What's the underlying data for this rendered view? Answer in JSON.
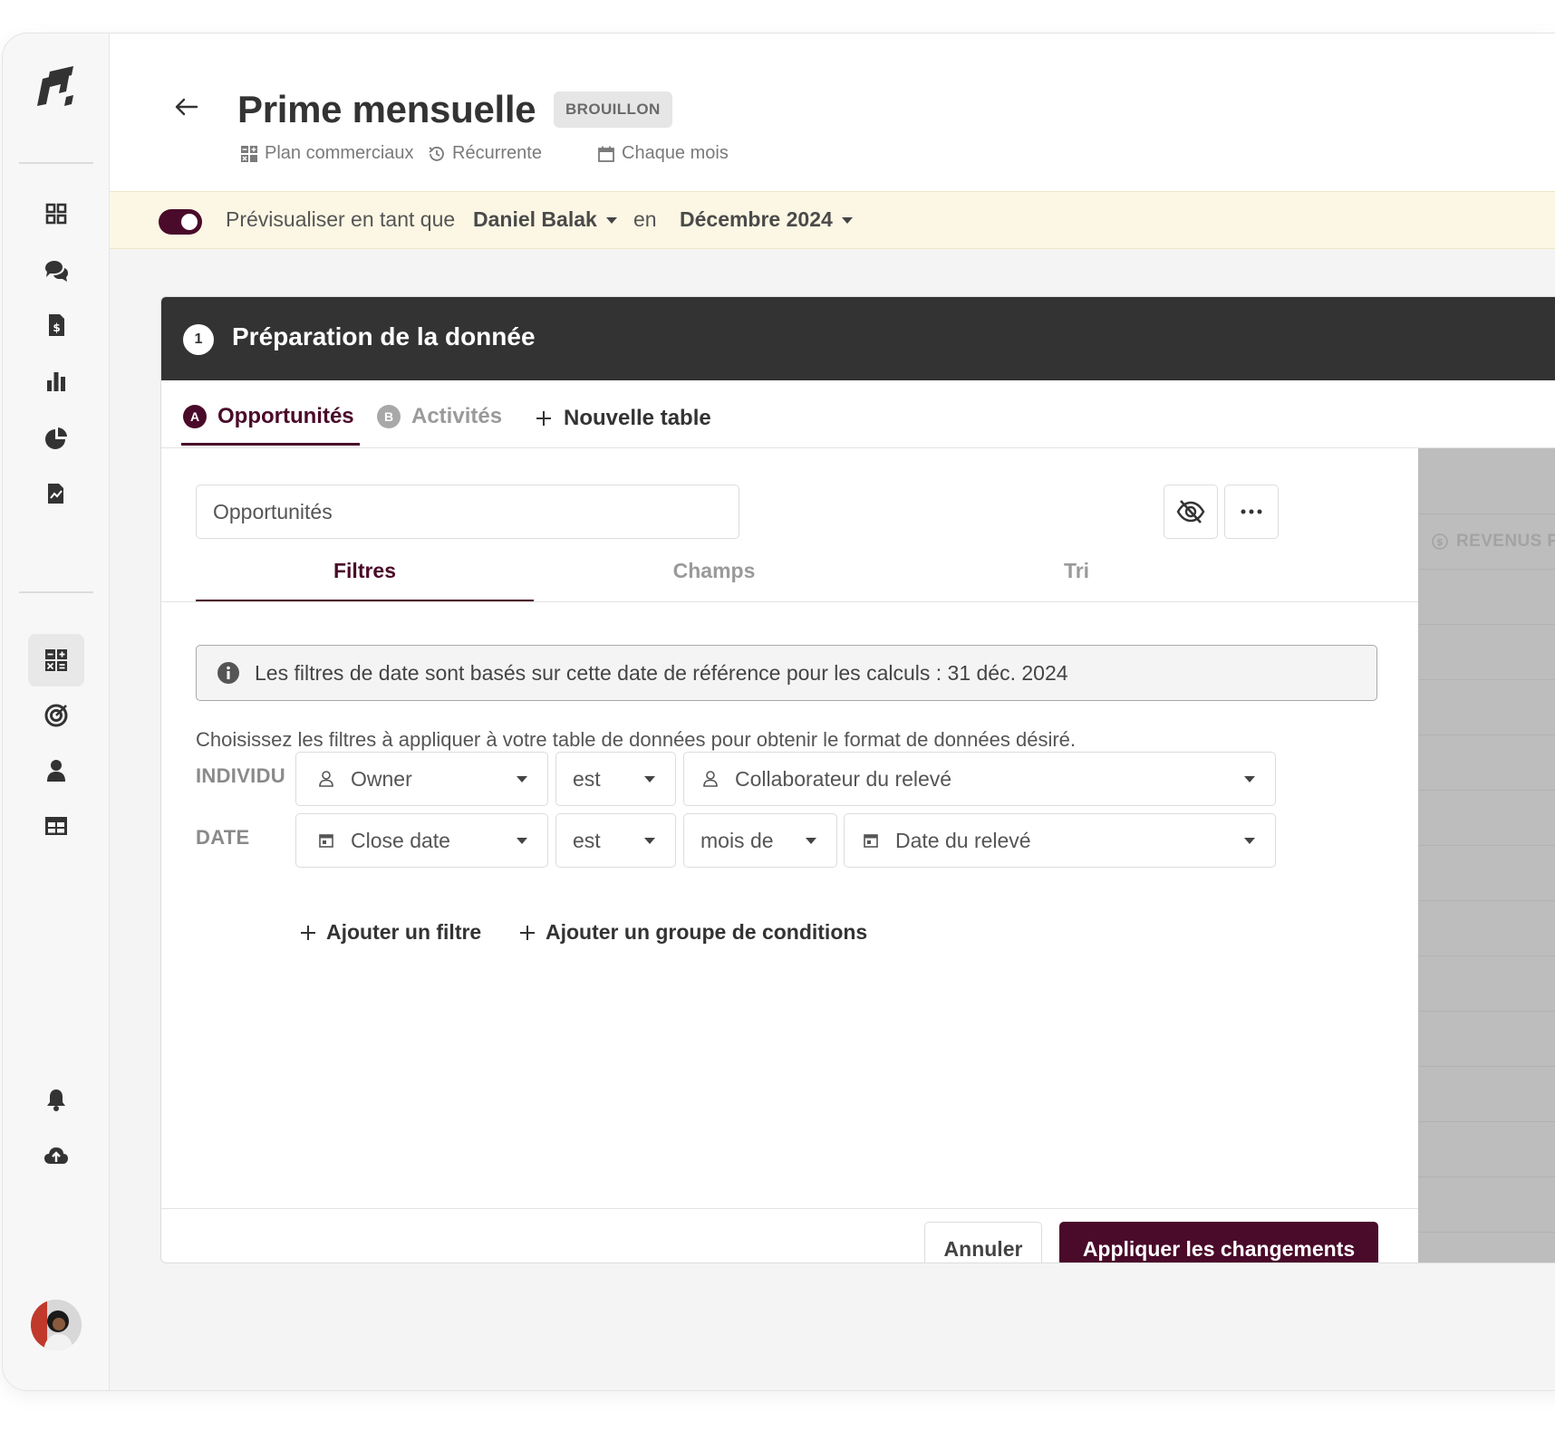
{
  "header": {
    "title": "Prime mensuelle",
    "badge": "BROUILLON",
    "meta": [
      {
        "icon": "grid-icon",
        "label": "Plan commerciaux"
      },
      {
        "icon": "history-icon",
        "label": "Récurrente"
      },
      {
        "icon": "calendar-icon",
        "label": "Chaque mois"
      }
    ]
  },
  "preview": {
    "toggle_on": true,
    "label": "Prévisualiser en tant que",
    "person": "Daniel Balak",
    "connector": "en",
    "period": "Décembre 2024"
  },
  "section": {
    "step": "1",
    "title": "Préparation de la donnée"
  },
  "tables": {
    "tabs": [
      {
        "letter": "A",
        "label": "Opportunités",
        "active": true
      },
      {
        "letter": "B",
        "label": "Activités",
        "active": false
      }
    ],
    "new_table": "Nouvelle table",
    "name_value": "Opportunités"
  },
  "subtabs": [
    "Filtres",
    "Champs",
    "Tri"
  ],
  "info": "Les filtres de date sont basés sur cette date de référence pour les calculs : 31 déc. 2024",
  "description": "Choisissez les filtres à appliquer à votre table de données pour obtenir le format de données désiré.",
  "filters": [
    {
      "label": "INDIVIDU",
      "field": "Owner",
      "field_icon": "user-icon",
      "operator": "est",
      "value": "Collaborateur du relevé",
      "value_icon": "user-icon"
    },
    {
      "label": "DATE",
      "field": "Close date",
      "field_icon": "calendar-icon",
      "operator": "est",
      "modifier": "mois de",
      "value": "Date du relevé",
      "value_icon": "calendar-icon"
    }
  ],
  "actions": {
    "add_filter": "Ajouter un filtre",
    "add_group": "Ajouter un groupe de conditions",
    "cancel": "Annuler",
    "apply": "Appliquer les changements"
  },
  "side_panel": {
    "column_header": "REVENUS PI"
  },
  "colors": {
    "accent": "#4a0a2a",
    "preview_bg": "#fbf7e4",
    "section_header": "#333333"
  }
}
